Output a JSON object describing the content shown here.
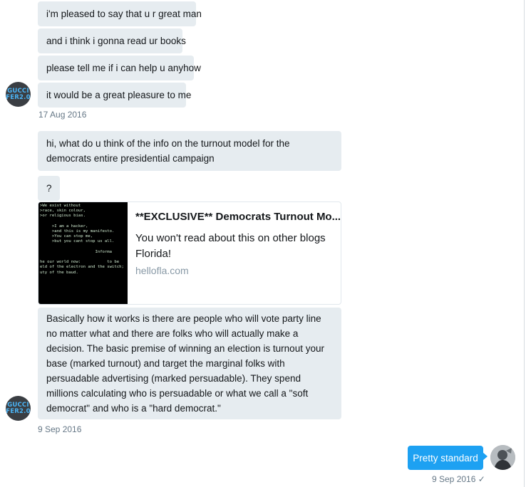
{
  "conversation": {
    "block1": [
      "i'm pleased to say that u r great man",
      "and i think i gonna read ur books",
      "please tell me if i can help u anyhow",
      "it would be a great pleasure to me"
    ],
    "avatar_text_line1": "GUCCI",
    "avatar_text_line2": "FER2.0",
    "date1": "17 Aug 2016",
    "block2_msg1": "hi, what do u think of the info on the turnout model for the democrats entire presidential campaign",
    "block2_msg2": "?",
    "link_card": {
      "thumb_lines": [
        ">We exist without",
        ">race, skin colour,",
        ">or religious bias.",
        "",
        "     >I am a hacker,",
        "     >and this is my manifesto.",
        "     >You can stop me,",
        "     >but you cant stop us all.",
        "",
        "                       Informa",
        "",
        "he our world now:           to be",
        "eld of the electron and the switch;",
        "uty of the baud."
      ],
      "title": "**EXCLUSIVE** Democrats Turnout Mo...",
      "description": "You won't read about this on other blogs Florida!",
      "domain": "hellofla.com"
    },
    "block2_msg3": "Basically how it works is there are people who will vote party line no matter what and there are folks who will actually make a decision.  The basic premise of winning an election is turnout your base (marked turnout) and target the marginal folks with persuadable advertising (marked persuadable). They spend millions calculating  who is persuadable or what we call a \"soft democrat\" and who is a \"hard democrat.\"",
    "date2": "9 Sep 2016",
    "sent_message": "Pretty standard",
    "sent_date": "9 Sep 2016",
    "read_check": "✓"
  },
  "colors": {
    "received_bubble": "#e6ecf0",
    "sent_bubble": "#1da1f2",
    "timestamp": "#657786",
    "avatar_bg": "#3a3e43",
    "avatar_text": "#4ab3f4"
  },
  "icons": [
    "avatar-gucci",
    "avatar-me",
    "checkmark-icon"
  ]
}
